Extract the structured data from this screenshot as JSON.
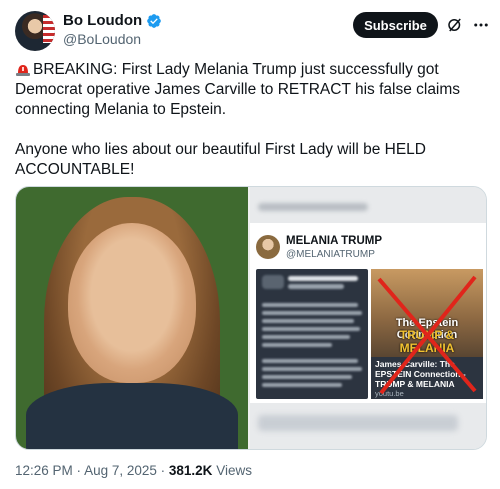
{
  "author": {
    "display_name": "Bo Loudon",
    "handle": "@BoLoudon"
  },
  "subscribe_label": "Subscribe",
  "icons": {
    "verified": "verified-badge-icon",
    "grok": "grok-icon",
    "more": "more-icon",
    "siren": "siren-emoji-icon"
  },
  "colors": {
    "verified": "#1d9bf0",
    "subscribe_bg": "#0f1419",
    "secondary_text": "#536471",
    "red_x": "#e0251b"
  },
  "tweet": {
    "text": "BREAKING: First Lady Melania Trump just successfully got Democrat operative James Carville to RETRACT his false claims connecting Melania to Epstein.\n\nAnyone who lies about our beautiful First Lady will be HELD ACCOUNTABLE!"
  },
  "screenshot": {
    "name": "MELANIA TRUMP",
    "handle": "@MELANIATRUMP",
    "thumb_headline_1": "The Epstein Connection",
    "thumb_headline_2": "TRUMP & MELANIA",
    "thumb_caption": "James Carville: The EPSTEIN Connection - TRUMP & MELANIA",
    "thumb_domain": "youtu.be"
  },
  "meta": {
    "time": "12:26 PM",
    "date": "Aug 7, 2025",
    "views_count": "381.2K",
    "views_label": "Views"
  }
}
